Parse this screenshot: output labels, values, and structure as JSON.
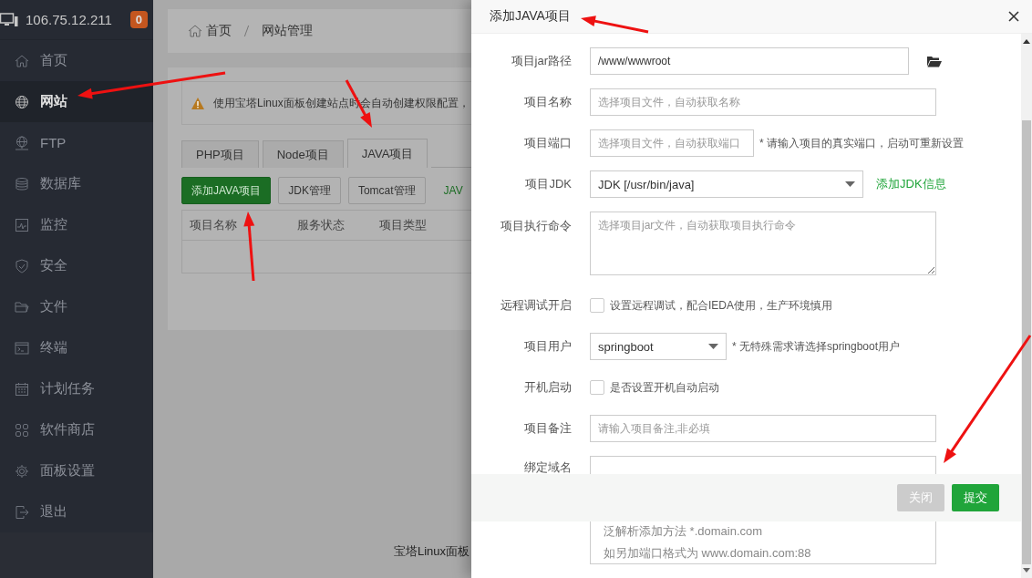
{
  "sidebar": {
    "host": "106.75.12.211",
    "badge": "0",
    "items": [
      {
        "label": "首页",
        "selected": false
      },
      {
        "label": "网站",
        "selected": true
      },
      {
        "label": "FTP",
        "selected": false
      },
      {
        "label": "数据库",
        "selected": false
      },
      {
        "label": "监控",
        "selected": false
      },
      {
        "label": "安全",
        "selected": false
      },
      {
        "label": "文件",
        "selected": false
      },
      {
        "label": "终端",
        "selected": false
      },
      {
        "label": "计划任务",
        "selected": false
      },
      {
        "label": "软件商店",
        "selected": false
      },
      {
        "label": "面板设置",
        "selected": false
      },
      {
        "label": "退出",
        "selected": false
      }
    ]
  },
  "breadcrumb": [
    "首页",
    "网站管理"
  ],
  "alert": "使用宝塔Linux面板创建站点时会自动创建权限配置，",
  "tabs": [
    {
      "label": "PHP项目",
      "selected": false
    },
    {
      "label": "Node项目",
      "selected": false
    },
    {
      "label": "JAVA项目",
      "selected": true
    }
  ],
  "toolbar": [
    {
      "label": "添加JAVA项目",
      "kind": "primary"
    },
    {
      "label": "JDK管理",
      "kind": "default"
    },
    {
      "label": "Tomcat管理",
      "kind": "default"
    },
    {
      "label": "JAV",
      "kind": "link"
    }
  ],
  "table": {
    "columns": [
      "项目名称",
      "服务状态",
      "项目类型"
    ]
  },
  "footer": "宝塔Linux面板",
  "dialog": {
    "title": "添加JAVA项目",
    "fields": [
      {
        "label": "项目jar路径",
        "kind": "input",
        "value": "/www/wwwroot",
        "browse": true
      },
      {
        "label": "项目名称",
        "kind": "input",
        "placeholder": "选择项目文件，自动获取名称"
      },
      {
        "label": "项目端口",
        "kind": "short-input",
        "placeholder": "选择项目文件，自动获取端口",
        "hint": "* 请输入项目的真实端口，启动可重新设置"
      },
      {
        "label": "项目JDK",
        "kind": "select",
        "value": "JDK [/usr/bin/java]",
        "link": "添加JDK信息"
      },
      {
        "label": "项目执行命令",
        "kind": "textarea",
        "placeholder": "选择项目jar文件，自动获取项目执行命令"
      },
      {
        "label": "远程调试开启",
        "kind": "checkbox",
        "checked": false,
        "text": "设置远程调试，配合IEDA使用，生产环境慎用"
      },
      {
        "label": "项目用户",
        "kind": "short-select",
        "value": "springboot",
        "hint": "* 无特殊需求请选择springboot用户"
      },
      {
        "label": "开机启动",
        "kind": "checkbox",
        "checked": false,
        "text": "是否设置开机自动启动"
      },
      {
        "label": "项目备注",
        "kind": "input",
        "placeholder": "请输入项目备注,非必填"
      },
      {
        "label": "绑定域名",
        "kind": "lines",
        "lines": [
          "泛解析添加方法 *.domain.com",
          "如另加端口格式为 www.domain.com:88"
        ]
      }
    ],
    "buttons": [
      {
        "label": "关闭",
        "kind": "cancel"
      },
      {
        "label": "提交",
        "kind": "submit"
      }
    ]
  }
}
